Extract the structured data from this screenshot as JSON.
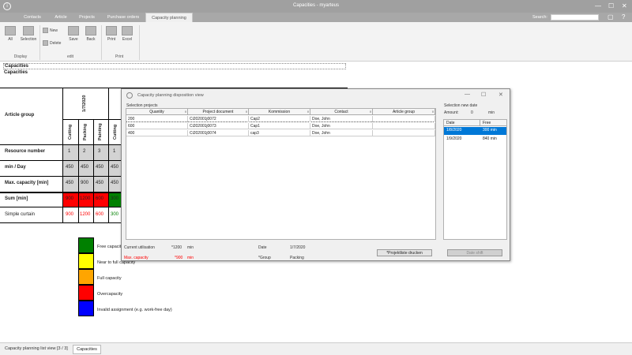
{
  "window": {
    "title": "Capacities - myarteus",
    "min_glyph": "—",
    "max_glyph": "☐",
    "close_glyph": "✕",
    "restore_glyph": "▢",
    "help_glyph": "?",
    "logo_glyph": "i"
  },
  "tabs": [
    {
      "label": "Contacts"
    },
    {
      "label": "Article"
    },
    {
      "label": "Projects"
    },
    {
      "label": "Purchase orders"
    },
    {
      "label": "Capacity planning"
    }
  ],
  "search": {
    "label": "Search:",
    "value": ""
  },
  "ribbon": {
    "all": "All",
    "selection": "Selection",
    "new": "New",
    "delete": "Delete",
    "save": "Save",
    "back": "Back",
    "print": "Print",
    "excel": "Excel",
    "group_display": "Display",
    "group_edit": "edit",
    "group_print": "Print"
  },
  "sheet": {
    "caption": "Capacities",
    "subcaption": "Capacities",
    "article_group": "Article group",
    "date": "1/7/2020",
    "resource_label": "Resource number",
    "min_day_label": "min / Day",
    "max_cap_label": "Max. capacity [min]",
    "sum_label": "Sum [min]",
    "row_label": "Simple curtain",
    "cols": [
      {
        "name": "Cutting",
        "res": "1",
        "min": "450",
        "max": "450",
        "sum": "900",
        "val": "900"
      },
      {
        "name": "Packing",
        "res": "2",
        "min": "450",
        "max": "900",
        "sum": "1200",
        "val": "1200"
      },
      {
        "name": "Painting",
        "res": "3",
        "min": "450",
        "max": "450",
        "sum": "600",
        "val": "600"
      },
      {
        "name": "Cutting",
        "res": "1",
        "min": "450",
        "max": "450",
        "sum": "300",
        "val": "300"
      }
    ]
  },
  "legend": [
    {
      "label": "Free capacity",
      "color": "#008000"
    },
    {
      "label": "Near to full capacity",
      "color": "#ffff00"
    },
    {
      "label": "Full capacity",
      "color": "#ffa500"
    },
    {
      "label": "Overcapacity",
      "color": "#ff0000"
    },
    {
      "label": "Invalid assignment (e.g. work-free day)",
      "color": "#0000ff"
    }
  ],
  "colors": {
    "over": "#ff0000",
    "free": "#008000",
    "selection": "#0078d7"
  },
  "dialog": {
    "title": "Capacity planning disposition view",
    "selection_projects": "Selection projects",
    "headers": [
      "Quantity",
      "Project document",
      "Kommission",
      "Contact",
      "Article group"
    ],
    "rows": [
      {
        "quantity": "200",
        "doc": "Ci202001j0072",
        "kommission": "Cap2",
        "contact": "Doe, John",
        "group": ""
      },
      {
        "quantity": "600",
        "doc": "Ci202001j0073",
        "kommission": "Cap1",
        "contact": "Doe, John",
        "group": ""
      },
      {
        "quantity": "400",
        "doc": "Ci202001j0074",
        "kommission": "cap3",
        "contact": "Doe, John",
        "group": ""
      }
    ],
    "new_date_title": "Selection new date",
    "amount_label": "Amount:",
    "amount_value": "0",
    "amount_unit": "min",
    "date_headers": [
      "Date",
      "Free"
    ],
    "dates": [
      {
        "date": "1/8/2020",
        "free": "300 min"
      },
      {
        "date": "1/9/2020",
        "free": "840 min"
      }
    ],
    "current_label": "Current utilisation",
    "current_value": "*1200",
    "current_unit": "min",
    "max_label": "Max. capacity",
    "max_value": "*900",
    "max_unit": "min",
    "date_label": "Date",
    "date_value": "1/7/2020",
    "group_label": "*Group",
    "group_value": "Packing",
    "print_button": "*Projektliste drucken",
    "shift_button": "Date shift"
  },
  "statusbar": {
    "list_view": "Capacity planning list view [3 / 3]",
    "tab": "Capacities"
  }
}
